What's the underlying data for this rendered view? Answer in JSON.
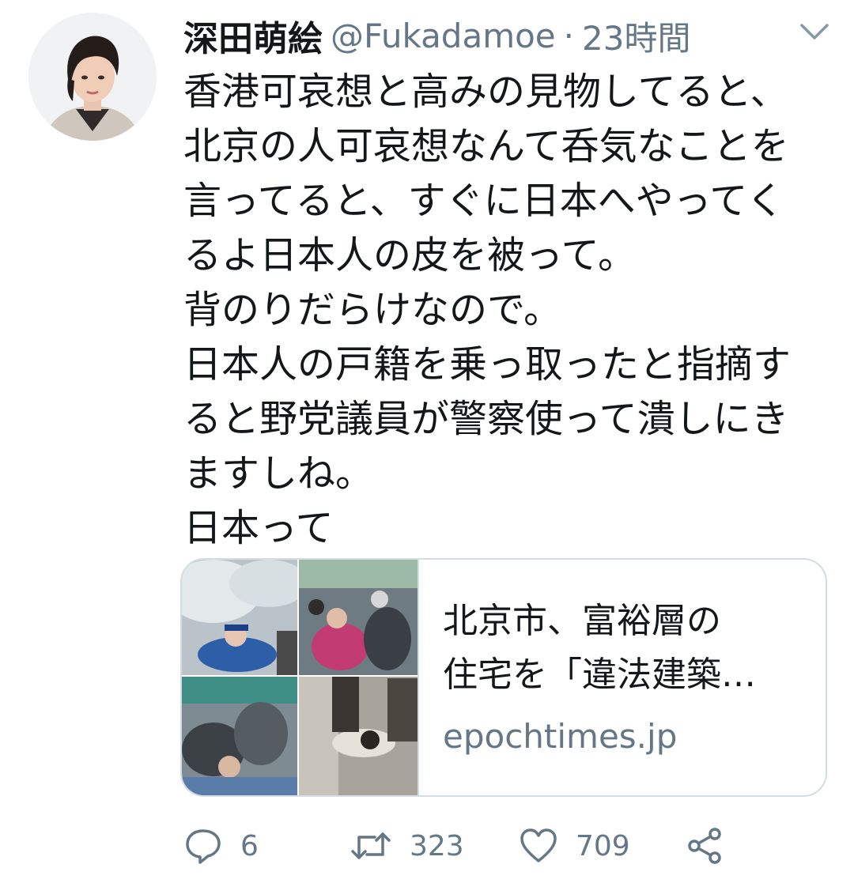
{
  "tweet": {
    "display_name": "深田萌絵",
    "handle": "@Fukadamoe",
    "separator": "·",
    "timestamp": "23時間",
    "lines": [
      "香港可哀想と高みの見物してると、",
      "北京の人可哀想なんて呑気なことを",
      "言ってると、すぐに日本へやってく",
      "るよ日本人の皮を被って。",
      "背のりだらけなので。",
      "日本人の戸籍を乗っ取ったと指摘す",
      "ると野党議員が警察使って潰しにき",
      "ますしね。",
      "日本って"
    ]
  },
  "card": {
    "title_lines": [
      "北京市、富裕層の",
      "住宅を「違法建築…"
    ],
    "domain": "epochtimes.jp"
  },
  "actions": {
    "reply_count": "6",
    "retweet_count": "323",
    "like_count": "709"
  },
  "colors": {
    "text": "#14171a",
    "secondary": "#657786",
    "border": "#d5dde3",
    "icon": "#657786"
  },
  "icons": {
    "caret": "chevron-down-icon",
    "reply": "reply-icon",
    "retweet": "retweet-icon",
    "like": "heart-icon",
    "share": "share-icon"
  }
}
